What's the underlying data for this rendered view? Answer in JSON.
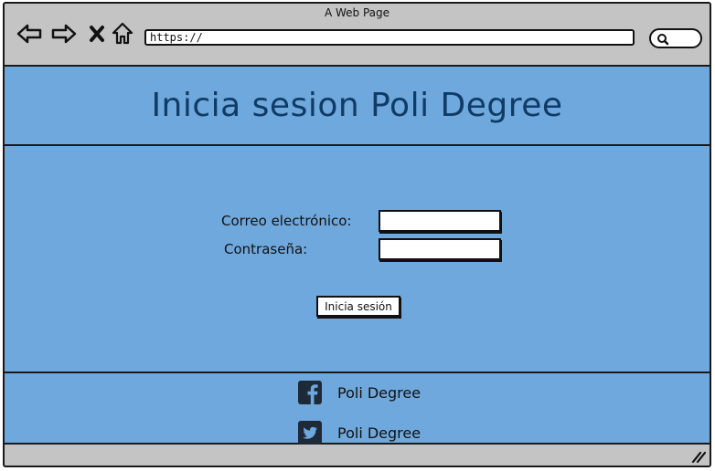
{
  "window": {
    "title": "A Web Page"
  },
  "browser": {
    "url": "https://",
    "icons": {
      "back": "back-arrow-icon",
      "forward": "forward-arrow-icon",
      "close": "close-x-icon",
      "home": "home-icon",
      "search": "search-icon"
    }
  },
  "hero": {
    "title": "Inicia sesion Poli Degree"
  },
  "login_form": {
    "email_label": "Correo electrónico:",
    "email_value": "",
    "password_label": "Contraseña:",
    "password_value": "",
    "submit_label": "Inicia sesión"
  },
  "footer": {
    "facebook": {
      "icon": "facebook-icon",
      "label": "Poli Degree"
    },
    "twitter": {
      "icon": "twitter-icon",
      "label": "Poli Degree"
    }
  },
  "colors": {
    "page_background": "#6fa8dc",
    "title_color": "#0f3b66",
    "chrome_gray": "#c4c4c4"
  }
}
